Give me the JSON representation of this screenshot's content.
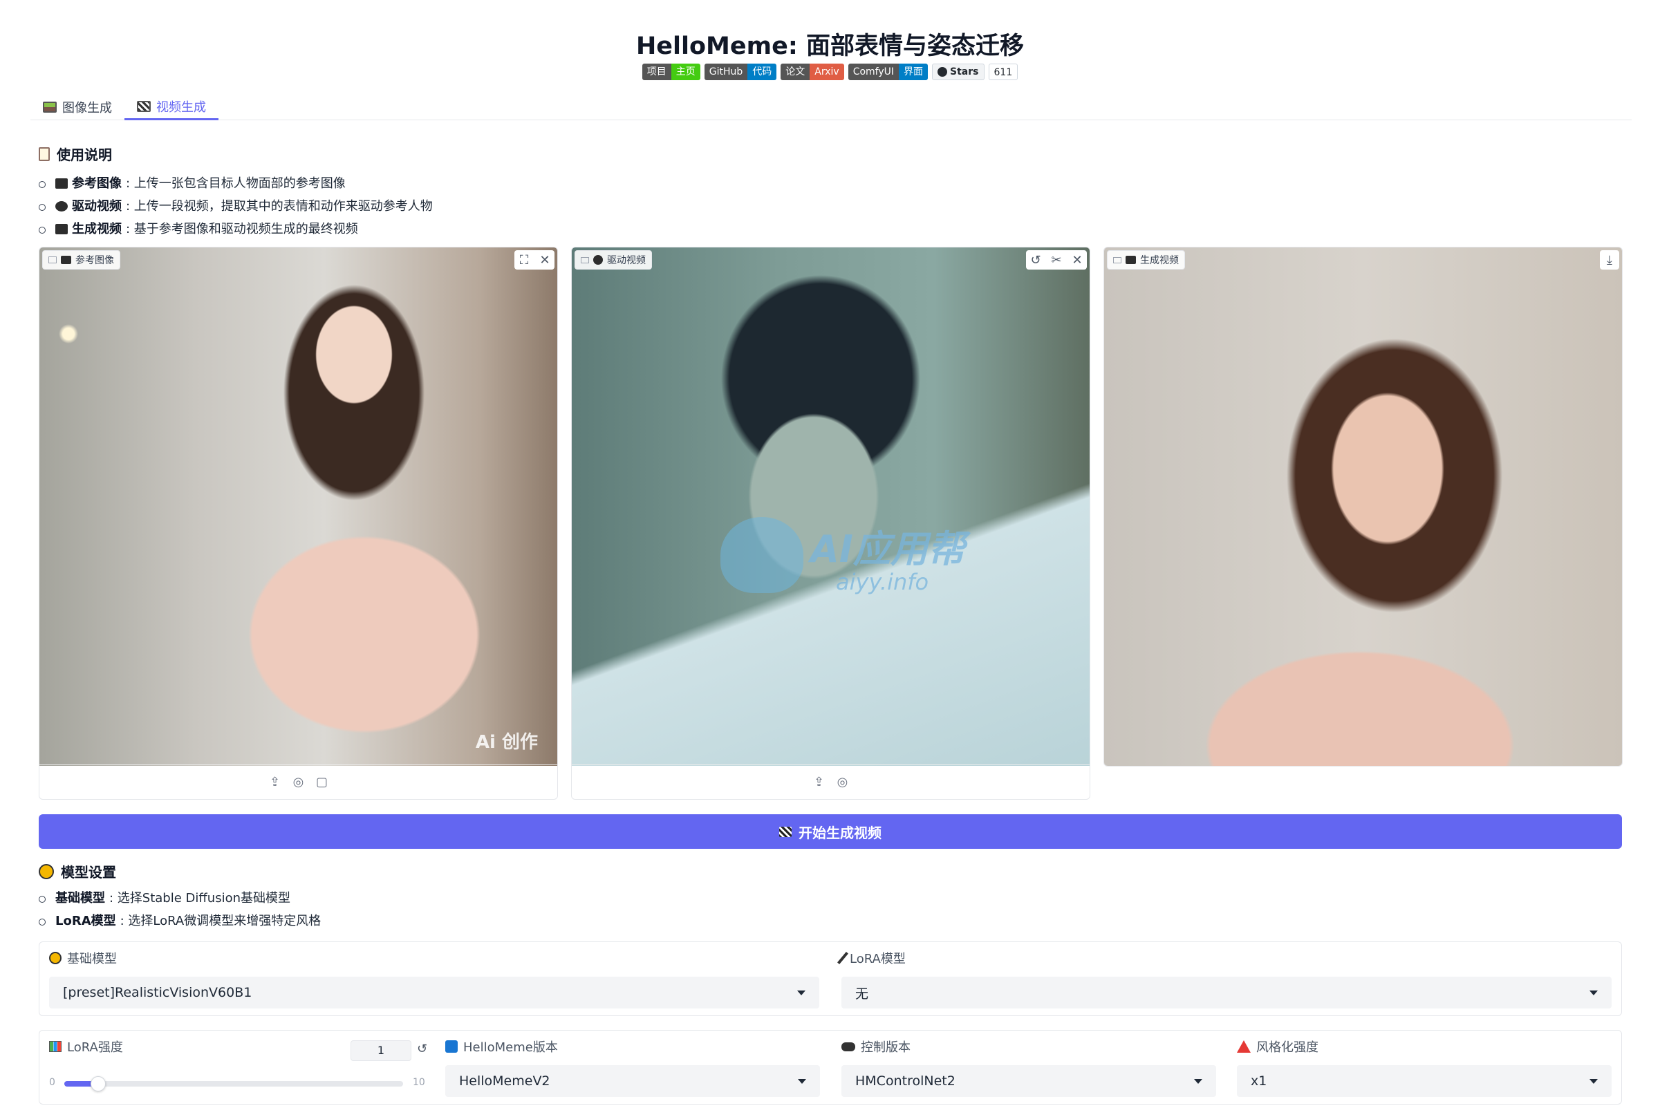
{
  "header": {
    "title": "HelloMeme: 面部表情与姿态迁移",
    "badges": [
      {
        "left": "项目",
        "right": "主页",
        "color": "#44cc11"
      },
      {
        "left": "GitHub",
        "right": "代码",
        "color": "#007ec6"
      },
      {
        "left": "论文",
        "right": "Arxiv",
        "color": "#e05d44"
      },
      {
        "left": "ComfyUI",
        "right": "界面",
        "color": "#007ec6"
      }
    ],
    "stars_label": "Stars",
    "stars_count": "611"
  },
  "tabs": [
    {
      "label": "图像生成",
      "icon": "picture-icon"
    },
    {
      "label": "视频生成",
      "icon": "clapper-icon",
      "active": true
    }
  ],
  "instructions": {
    "title": "使用说明",
    "items": [
      {
        "term": "参考图像",
        "text": ": 上传一张包含目标人物面部的参考图像"
      },
      {
        "term": "驱动视频",
        "text": ": 上传一段视频，提取其中的表情和动作来驱动参考人物"
      },
      {
        "term": "生成视频",
        "text": ": 基于参考图像和驱动视频生成的最终视频"
      }
    ]
  },
  "panels": {
    "reference": {
      "label": "参考图像"
    },
    "driving": {
      "label": "驱动视频",
      "watermark_title": "AI应用帮",
      "watermark_url": "aiyy.info"
    },
    "generated": {
      "label": "生成视频"
    },
    "reference_watermark": "Ai 创作"
  },
  "generate_button": "开始生成视频",
  "model_settings": {
    "title": "模型设置",
    "items": [
      {
        "term": "基础模型",
        "text": ": 选择Stable Diffusion基础模型"
      },
      {
        "term": "LoRA模型",
        "text": ": 选择LoRA微调模型来增强特定风格"
      }
    ]
  },
  "fields": {
    "base_model": {
      "label": "基础模型",
      "value": "[preset]RealisticVisionV60B1"
    },
    "lora_model": {
      "label": "LoRA模型",
      "value": "无"
    },
    "lora_strength": {
      "label": "LoRA强度",
      "value": "1",
      "min": "0",
      "max": "10",
      "fraction": 0.1
    },
    "hellomeme_version": {
      "label": "HelloMeme版本",
      "value": "HelloMemeV2"
    },
    "control_version": {
      "label": "控制版本",
      "value": "HMControlNet2"
    },
    "style_strength": {
      "label": "风格化强度",
      "value": "x1"
    }
  },
  "colors": {
    "accent": "#6366f1"
  }
}
